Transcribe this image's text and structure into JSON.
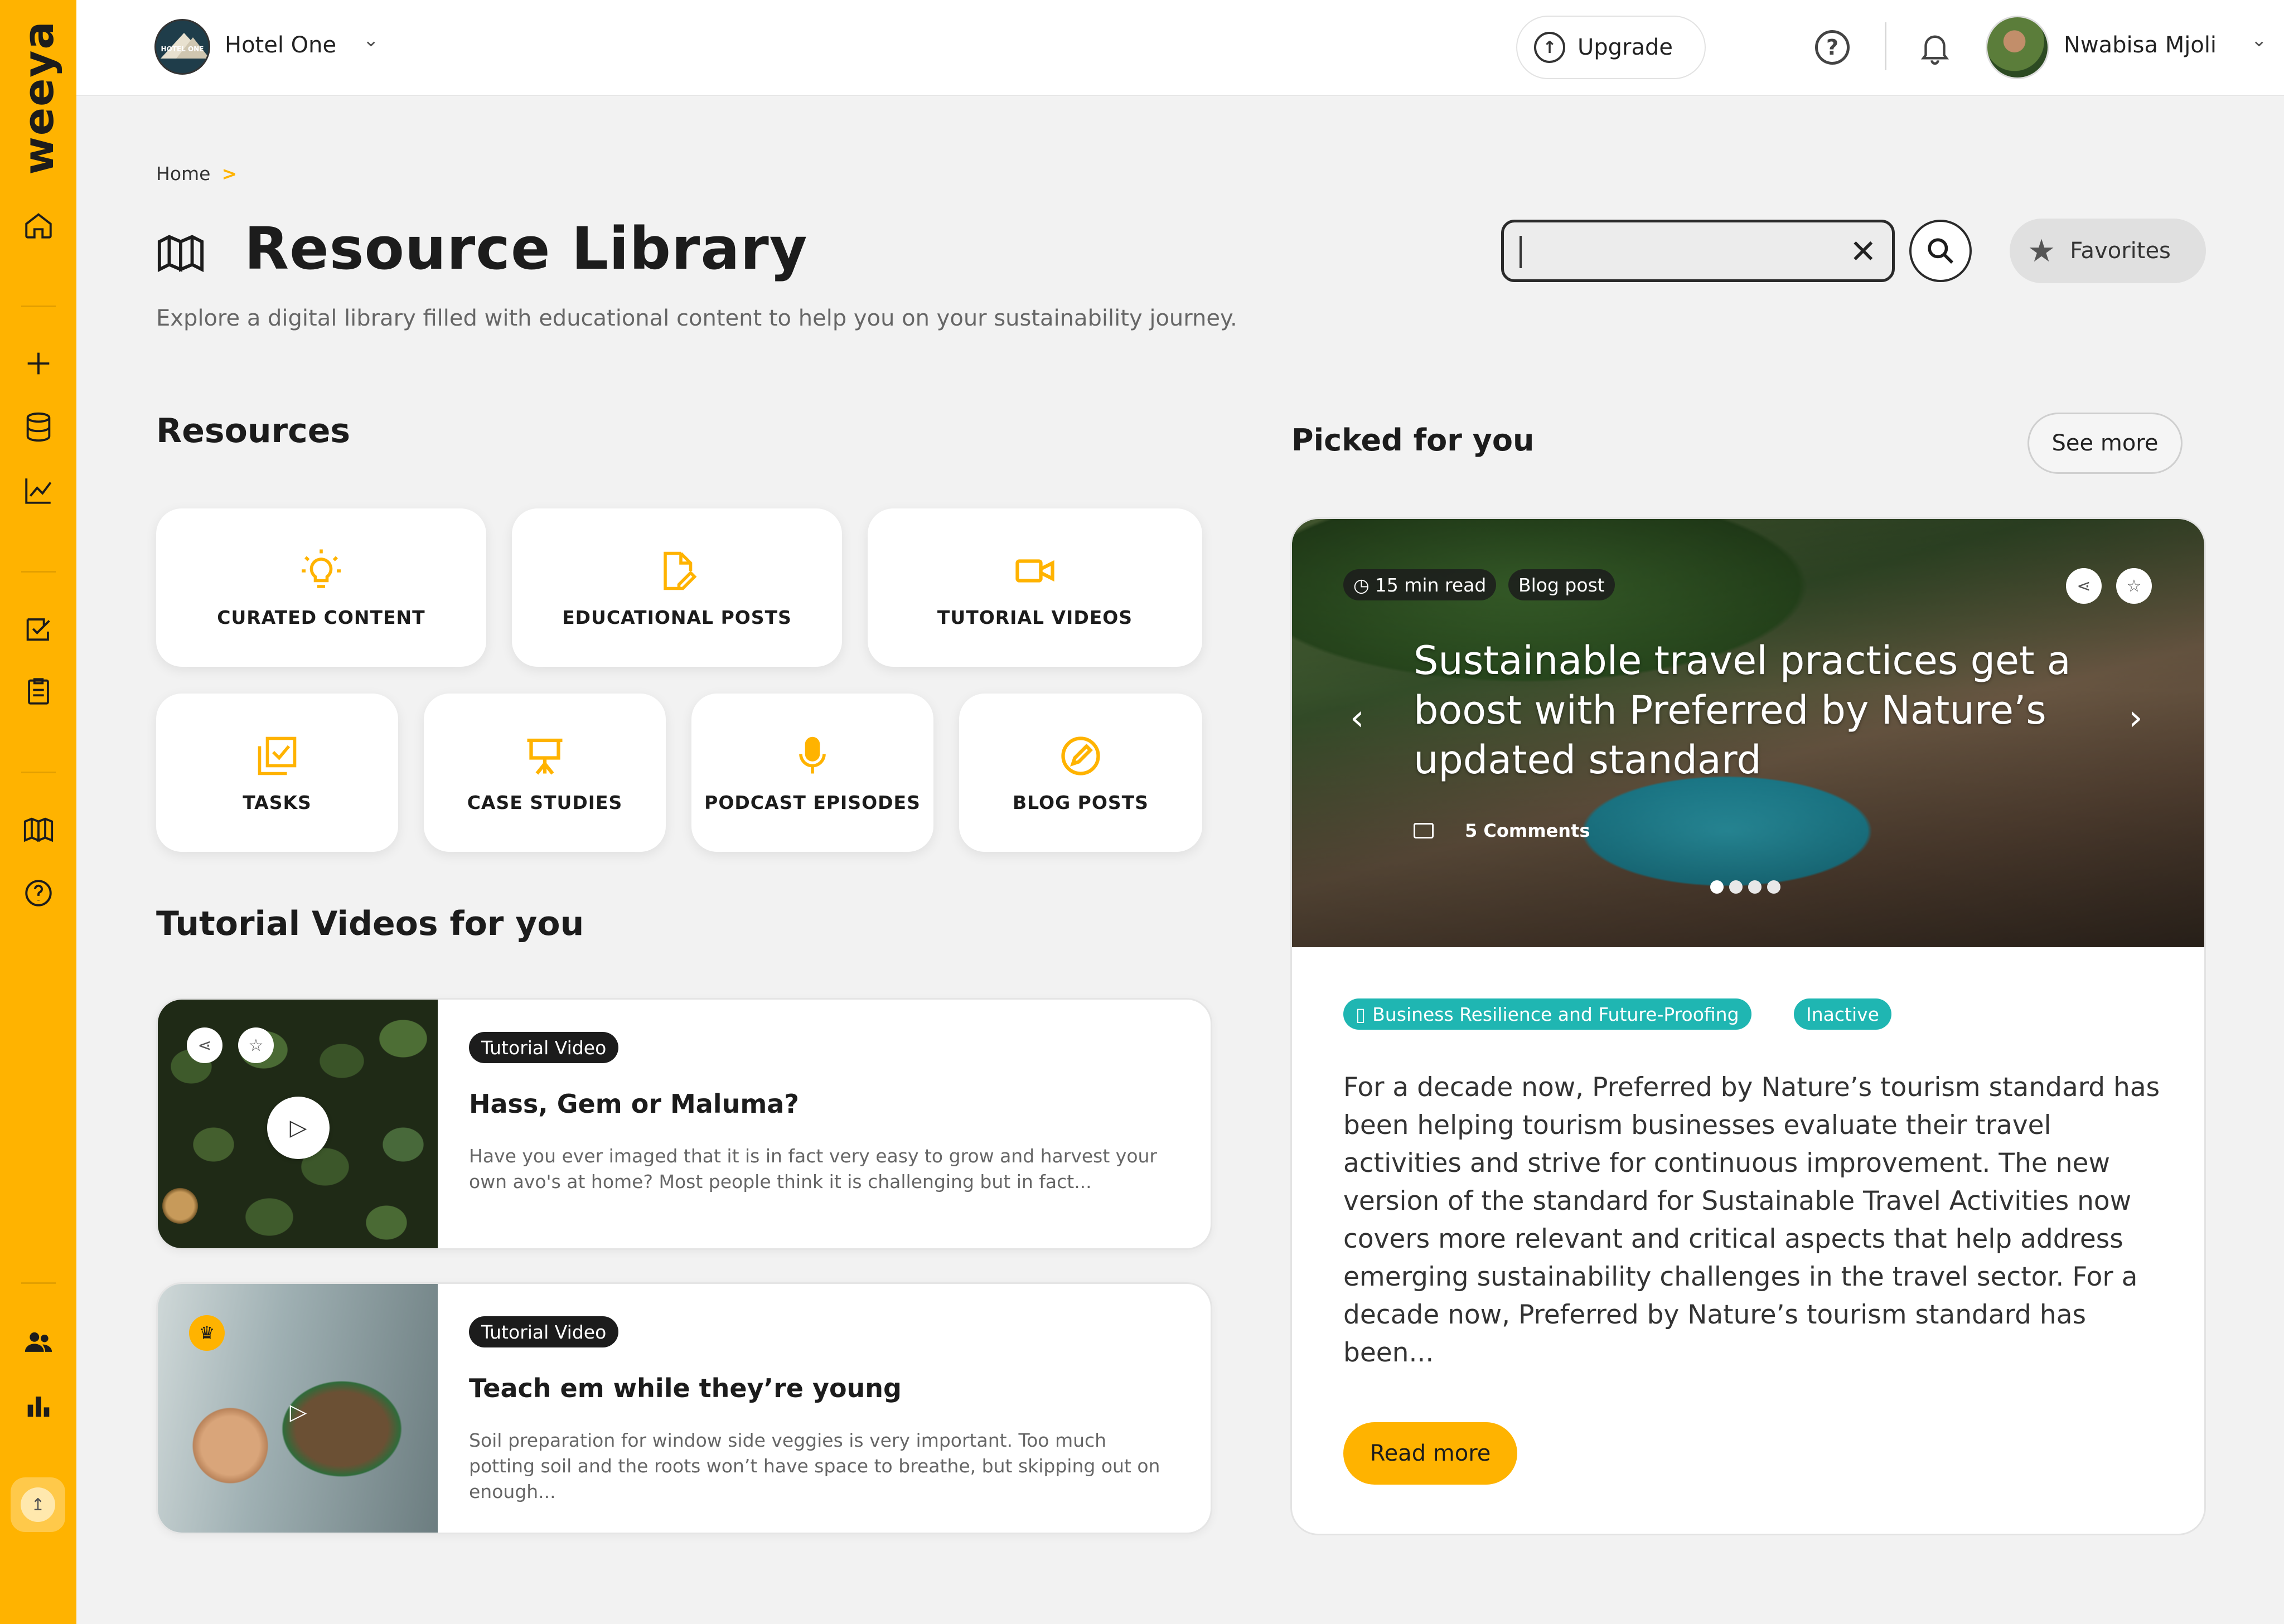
{
  "brand": "weeya",
  "colors": {
    "accent": "#ffb300",
    "teal": "#1fb6b2",
    "dark": "#1c1c1c"
  },
  "topbar": {
    "hotel_logo_text": "HOTEL ONE",
    "hotel_name": "Hotel One",
    "upgrade_label": "Upgrade",
    "user_name": "Nwabisa Mjoli"
  },
  "sidebar": {
    "items": [
      "home-icon",
      "plus-icon",
      "database-icon",
      "chart-line-icon",
      "checklist-icon",
      "clipboard-icon",
      "library-icon",
      "help-icon",
      "users-icon",
      "bar-chart-icon",
      "upload-icon"
    ]
  },
  "breadcrumb": {
    "home": "Home",
    "separator": ">"
  },
  "page": {
    "title": "Resource Library",
    "subtitle": "Explore a digital library filled with educational content to help you on your sustainability journey."
  },
  "search": {
    "value": "",
    "placeholder": ""
  },
  "favorites_label": "Favorites",
  "resources": {
    "title": "Resources",
    "items": [
      {
        "label": "CURATED CONTENT",
        "icon": "lightbulb-icon"
      },
      {
        "label": "EDUCATIONAL POSTS",
        "icon": "document-edit-icon"
      },
      {
        "label": "TUTORIAL VIDEOS",
        "icon": "video-camera-icon"
      },
      {
        "label": "TASKS",
        "icon": "tasks-icon"
      },
      {
        "label": "CASE STUDIES",
        "icon": "presentation-icon"
      },
      {
        "label": "PODCAST EPISODES",
        "icon": "microphone-icon"
      },
      {
        "label": "BLOG POSTS",
        "icon": "pencil-circle-icon"
      }
    ]
  },
  "tutorials": {
    "title": "Tutorial Videos for you",
    "items": [
      {
        "tag": "Tutorial Video",
        "title": "Hass, Gem or Maluma?",
        "desc": "Have you ever imaged that it is in fact very easy to grow and harvest your own avo's at home? Most people think it is challenging but in fact..."
      },
      {
        "tag": "Tutorial Video",
        "title": "Teach em while they’re young",
        "desc": "Soil preparation for window side veggies is very important. Too much potting soil and the roots won’t have space to breathe, but skipping out on enough..."
      }
    ]
  },
  "picked": {
    "title": "Picked for you",
    "see_more": "See more",
    "read_time": "15 min read",
    "type": "Blog post",
    "headline": "Sustainable travel practices get a boost with Preferred by Nature’s updated standard",
    "comments": "5 Comments",
    "carousel": {
      "slides": 4,
      "active": 1
    },
    "category": "Business Resilience and Future-Proofing",
    "status": "Inactive",
    "body": "For a decade now, Preferred by Nature’s tourism standard has been helping tourism businesses evaluate their travel activities and strive for continuous improvement. The new version of the standard for Sustainable Travel Activities now covers more relevant and critical aspects that help address emerging sustainability challenges in the travel sector. For a decade now, Preferred by Nature’s tourism standard has been...",
    "read_more": "Read more"
  }
}
